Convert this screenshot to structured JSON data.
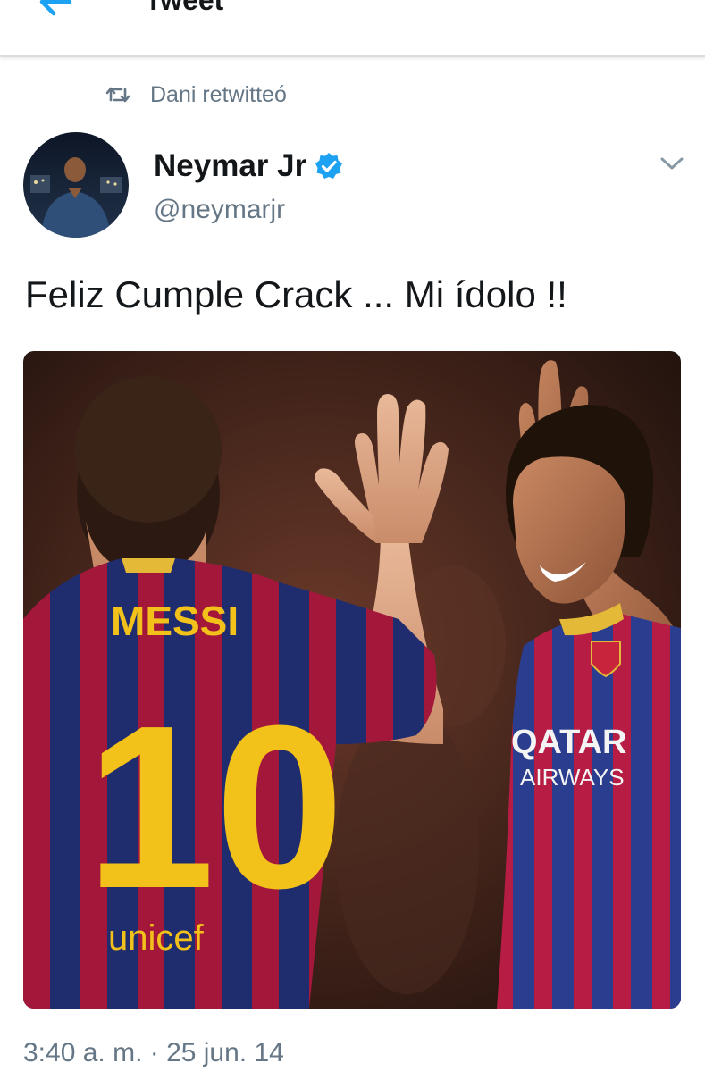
{
  "header": {
    "title": "Tweet",
    "back_icon": "back-arrow-icon",
    "accent": "#1da1f2"
  },
  "retweet": {
    "icon": "retweet-icon",
    "text": "Dani retwitteó"
  },
  "tweet": {
    "author": {
      "display_name": "Neymar Jr",
      "handle": "@neymarjr",
      "verified": true,
      "verified_color": "#1da1f2"
    },
    "text": "Feliz Cumple Crack ... Mi ídolo !!",
    "media": {
      "alt": "Photo of two FC Barcelona players high-fiving",
      "player_name": "MESSI",
      "player_number": "10",
      "sponsor_left": "unicef",
      "sponsor_right": [
        "QATAR",
        "AIRWAYS"
      ]
    },
    "timestamp": "3:40 a. m. · 25 jun. 14"
  },
  "colors": {
    "text_primary": "#14171a",
    "text_secondary": "#657786",
    "divider": "#d9dde1"
  }
}
